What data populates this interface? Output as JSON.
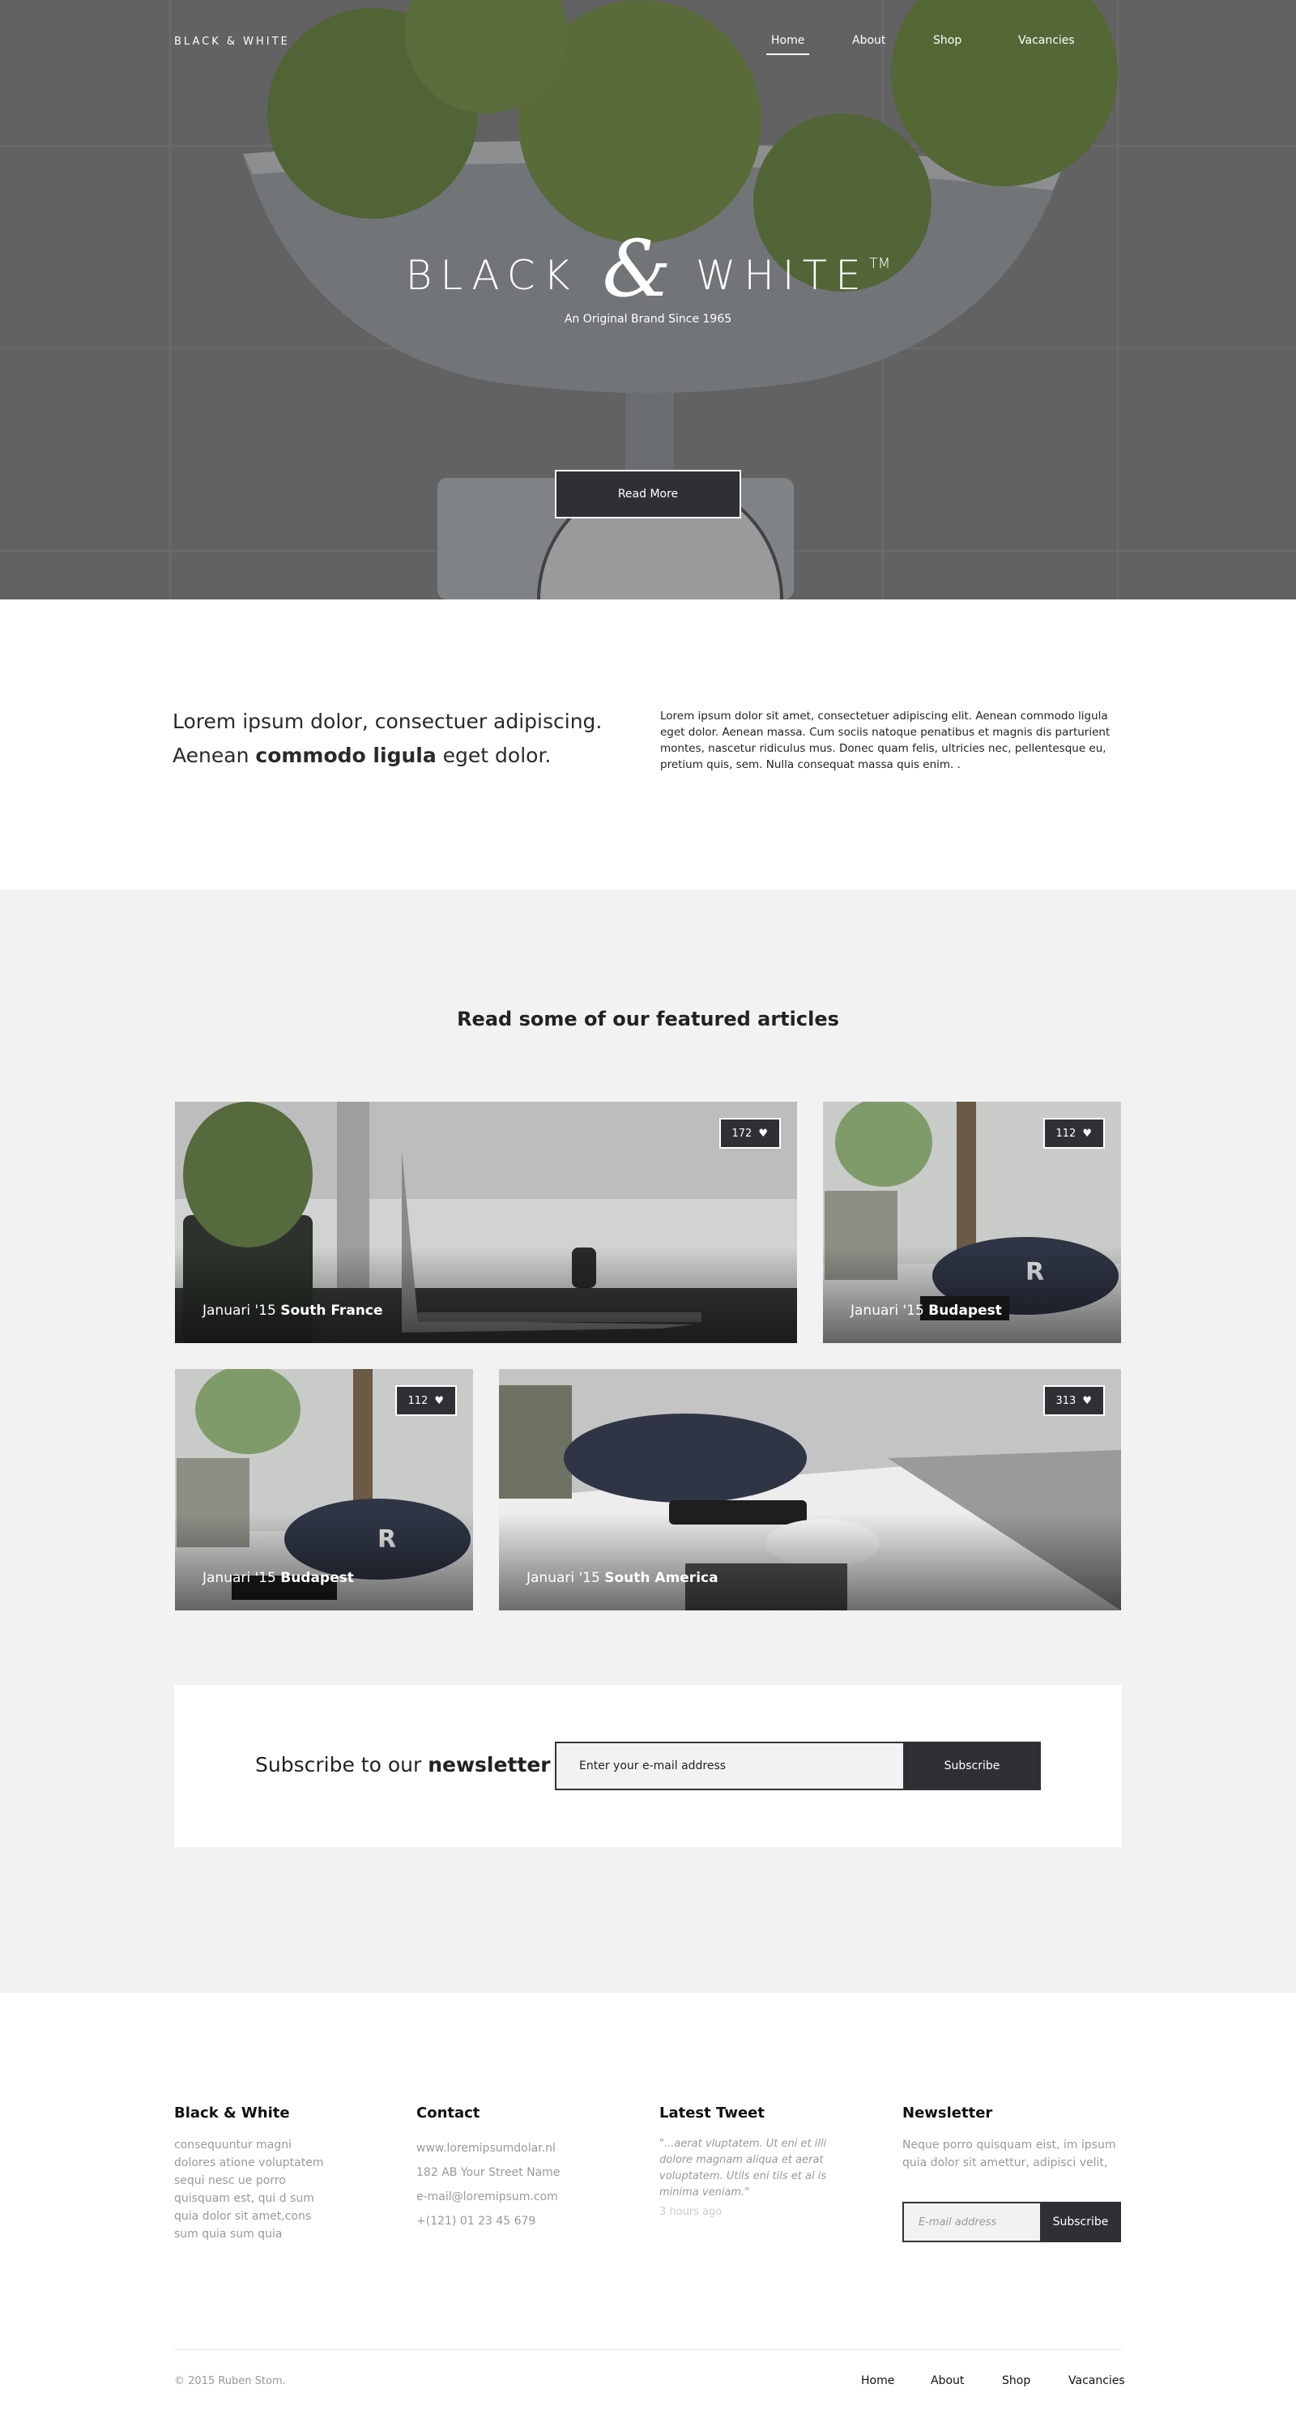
{
  "header": {
    "brand": "BLACK & WHITE",
    "nav": [
      "Home",
      "About",
      "Shop",
      "Vacancies"
    ],
    "active_nav": "Home"
  },
  "hero": {
    "title_left": "BLACK",
    "title_amp": "&",
    "title_right": "WHITE",
    "title_tm": "TM",
    "subtitle": "An Original Brand Since 1965",
    "button": "Read More"
  },
  "intro": {
    "line1": "Lorem ipsum dolor, consectuer adipiscing.",
    "line2_pre": "Aenean ",
    "line2_bold": "commodo ligula",
    "line2_post": " eget dolor.",
    "paragraph": "Lorem ipsum dolor sit amet, consectetuer adipiscing elit. Aenean commodo ligula eget dolor. Aenean massa. Cum sociis natoque penatibus et magnis dis parturient montes, nascetur ridiculus mus. Donec quam felis, ultricies nec, pellentesque eu, pretium quis, sem. Nulla consequat massa quis enim. ."
  },
  "featured": {
    "heading_pre": "Read some of our ",
    "heading_bold": "featured articles",
    "articles": [
      {
        "date": "Januari '15",
        "place": "South France",
        "likes": "172"
      },
      {
        "date": "Januari '15",
        "place": "Budapest",
        "likes": "112"
      },
      {
        "date": "Januari '15",
        "place": "Budapest",
        "likes": "112"
      },
      {
        "date": "Januari '15",
        "place": "South America",
        "likes": "313"
      }
    ]
  },
  "subscribe": {
    "title_pre": "Subscribe to our ",
    "title_bold": "newsletter",
    "placeholder": "Enter your e-mail address",
    "button": "Subscribe"
  },
  "footer": {
    "about": {
      "title": "Black & White",
      "text": "consequuntur magni dolores atione voluptatem sequi nesc ue porro quisquam est, qui d sum quia dolor sit amet,cons sum quia sum quia"
    },
    "contact": {
      "title": "Contact",
      "lines": [
        "www.loremipsumdolar.nl",
        "182 AB Your Street Name",
        "e-mail@loremipsum.com",
        "+(121) 01 23 45 679"
      ]
    },
    "tweet": {
      "title": "Latest Tweet",
      "text": "\"...aerat vluptatem. Ut eni et illi dolore magnam aliqua et aerat voluptatem. Utils eni tils  et al is minima veniam.\"",
      "time": "3 hours ago"
    },
    "newsletter": {
      "title": "Newsletter",
      "text": "Neque porro quisquam eist, im ipsum quia dolor sit amettur, adipisci velit,",
      "placeholder": "E-mail address",
      "button": "Subscribe"
    },
    "copyright": "© 2015 Ruben Stom.",
    "nav": [
      "Home",
      "About",
      "Shop",
      "Vacancies"
    ]
  }
}
